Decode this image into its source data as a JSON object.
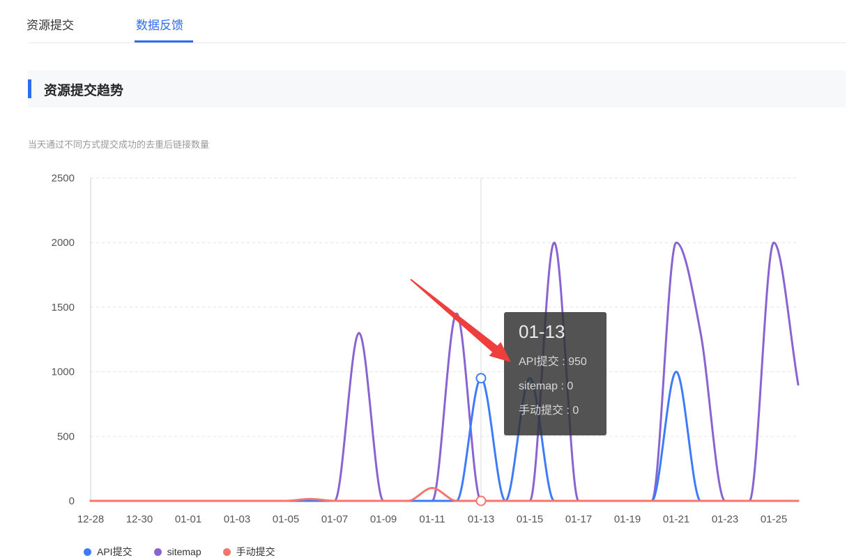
{
  "tabs": {
    "items": [
      {
        "label": "资源提交",
        "active": false
      },
      {
        "label": "数据反馈",
        "active": true
      }
    ]
  },
  "section": {
    "title": "资源提交趋势",
    "subtitle": "当天通过不同方式提交成功的去重后链接数量"
  },
  "colors": {
    "accent": "#2e6cf0",
    "arrow_red": "#ee3f3d",
    "tooltip_bg": "rgba(50,50,50,0.84)",
    "gridline": "#e2e2e2",
    "axis_line": "#cccccc",
    "tick_label": "#555555"
  },
  "chart_data": {
    "type": "line",
    "smooth": true,
    "grid": "horizontal-dashed",
    "legend_position": "bottom",
    "ylim": [
      0,
      2500
    ],
    "y_ticks": [
      0,
      500,
      1000,
      1500,
      2000,
      2500
    ],
    "x": [
      "12-28",
      "12-29",
      "12-30",
      "12-31",
      "01-01",
      "01-02",
      "01-03",
      "01-04",
      "01-05",
      "01-06",
      "01-07",
      "01-08",
      "01-09",
      "01-10",
      "01-11",
      "01-12",
      "01-13",
      "01-14",
      "01-15",
      "01-16",
      "01-17",
      "01-18",
      "01-19",
      "01-20",
      "01-21",
      "01-22",
      "01-23",
      "01-24",
      "01-25",
      "01-26"
    ],
    "x_tick_labels": [
      "12-28",
      "12-30",
      "01-01",
      "01-03",
      "01-05",
      "01-07",
      "01-09",
      "01-11",
      "01-13",
      "01-15",
      "01-17",
      "01-19",
      "01-21",
      "01-23",
      "01-25"
    ],
    "series": [
      {
        "name": "API提交",
        "color": "#3e7bfa",
        "values": [
          0,
          0,
          0,
          0,
          0,
          0,
          0,
          0,
          0,
          0,
          0,
          0,
          0,
          0,
          0,
          0,
          950,
          0,
          950,
          0,
          0,
          0,
          0,
          0,
          1000,
          0,
          0,
          0,
          0,
          0
        ]
      },
      {
        "name": "sitemap",
        "color": "#8a63d2",
        "values": [
          0,
          0,
          0,
          0,
          0,
          0,
          0,
          0,
          0,
          0,
          0,
          1300,
          0,
          0,
          0,
          1450,
          0,
          0,
          0,
          2000,
          0,
          0,
          0,
          0,
          2000,
          1300,
          0,
          0,
          2000,
          900
        ]
      },
      {
        "name": "手动提交",
        "color": "#f8756c",
        "values": [
          0,
          0,
          0,
          0,
          0,
          0,
          0,
          0,
          0,
          15,
          0,
          0,
          0,
          0,
          100,
          0,
          0,
          0,
          0,
          0,
          0,
          0,
          0,
          0,
          0,
          0,
          0,
          0,
          0,
          0
        ]
      }
    ]
  },
  "tooltip": {
    "title": "01-13",
    "date_index": 16,
    "separator": " : ",
    "lines": [
      {
        "label": "API提交",
        "value": "950"
      },
      {
        "label": "sitemap",
        "value": "0"
      },
      {
        "label": "手动提交",
        "value": "0"
      }
    ],
    "markers": [
      {
        "series": "API提交",
        "value": 950
      },
      {
        "series": "手动提交",
        "value": 0
      }
    ]
  }
}
